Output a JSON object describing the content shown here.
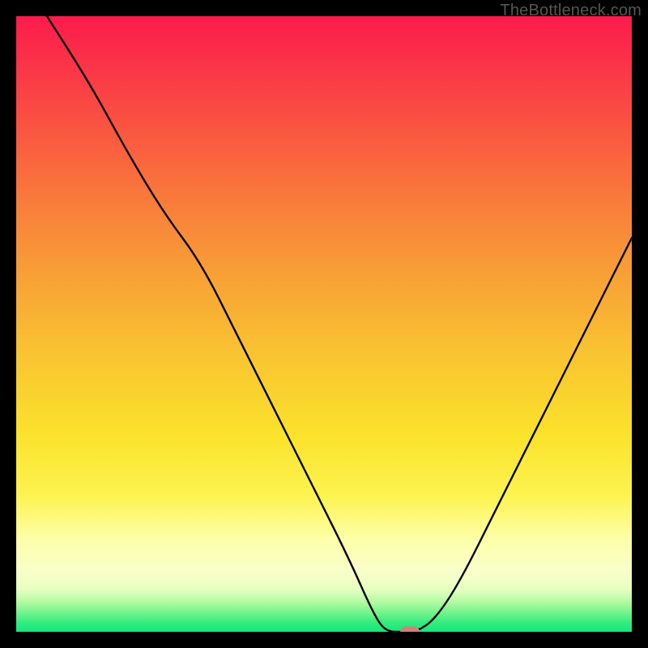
{
  "watermark": "TheBottleneck.com",
  "chart_data": {
    "type": "line",
    "title": "",
    "xlabel": "",
    "ylabel": "",
    "xlim": [
      0,
      100
    ],
    "ylim": [
      0,
      100
    ],
    "grid": false,
    "legend": false,
    "series": [
      {
        "name": "curve",
        "x": [
          5,
          12,
          18,
          24,
          30,
          36,
          42,
          48,
          54,
          58,
          60,
          63,
          65,
          68,
          72,
          78,
          85,
          92,
          100
        ],
        "values": [
          100,
          89,
          78,
          68,
          60,
          48,
          36,
          24,
          12,
          3,
          0,
          0,
          0,
          2,
          8,
          20,
          34,
          48,
          64
        ]
      }
    ],
    "marker": {
      "x": 64,
      "y": 0
    },
    "background_gradient": {
      "direction": "vertical",
      "stops": [
        {
          "pos": 0.0,
          "color": "#fc1b4b"
        },
        {
          "pos": 0.3,
          "color": "#f97b3b"
        },
        {
          "pos": 0.55,
          "color": "#f9c431"
        },
        {
          "pos": 0.78,
          "color": "#fdf351"
        },
        {
          "pos": 0.9,
          "color": "#f9ffc8"
        },
        {
          "pos": 0.97,
          "color": "#70f38b"
        },
        {
          "pos": 1.0,
          "color": "#11e87c"
        }
      ]
    }
  }
}
